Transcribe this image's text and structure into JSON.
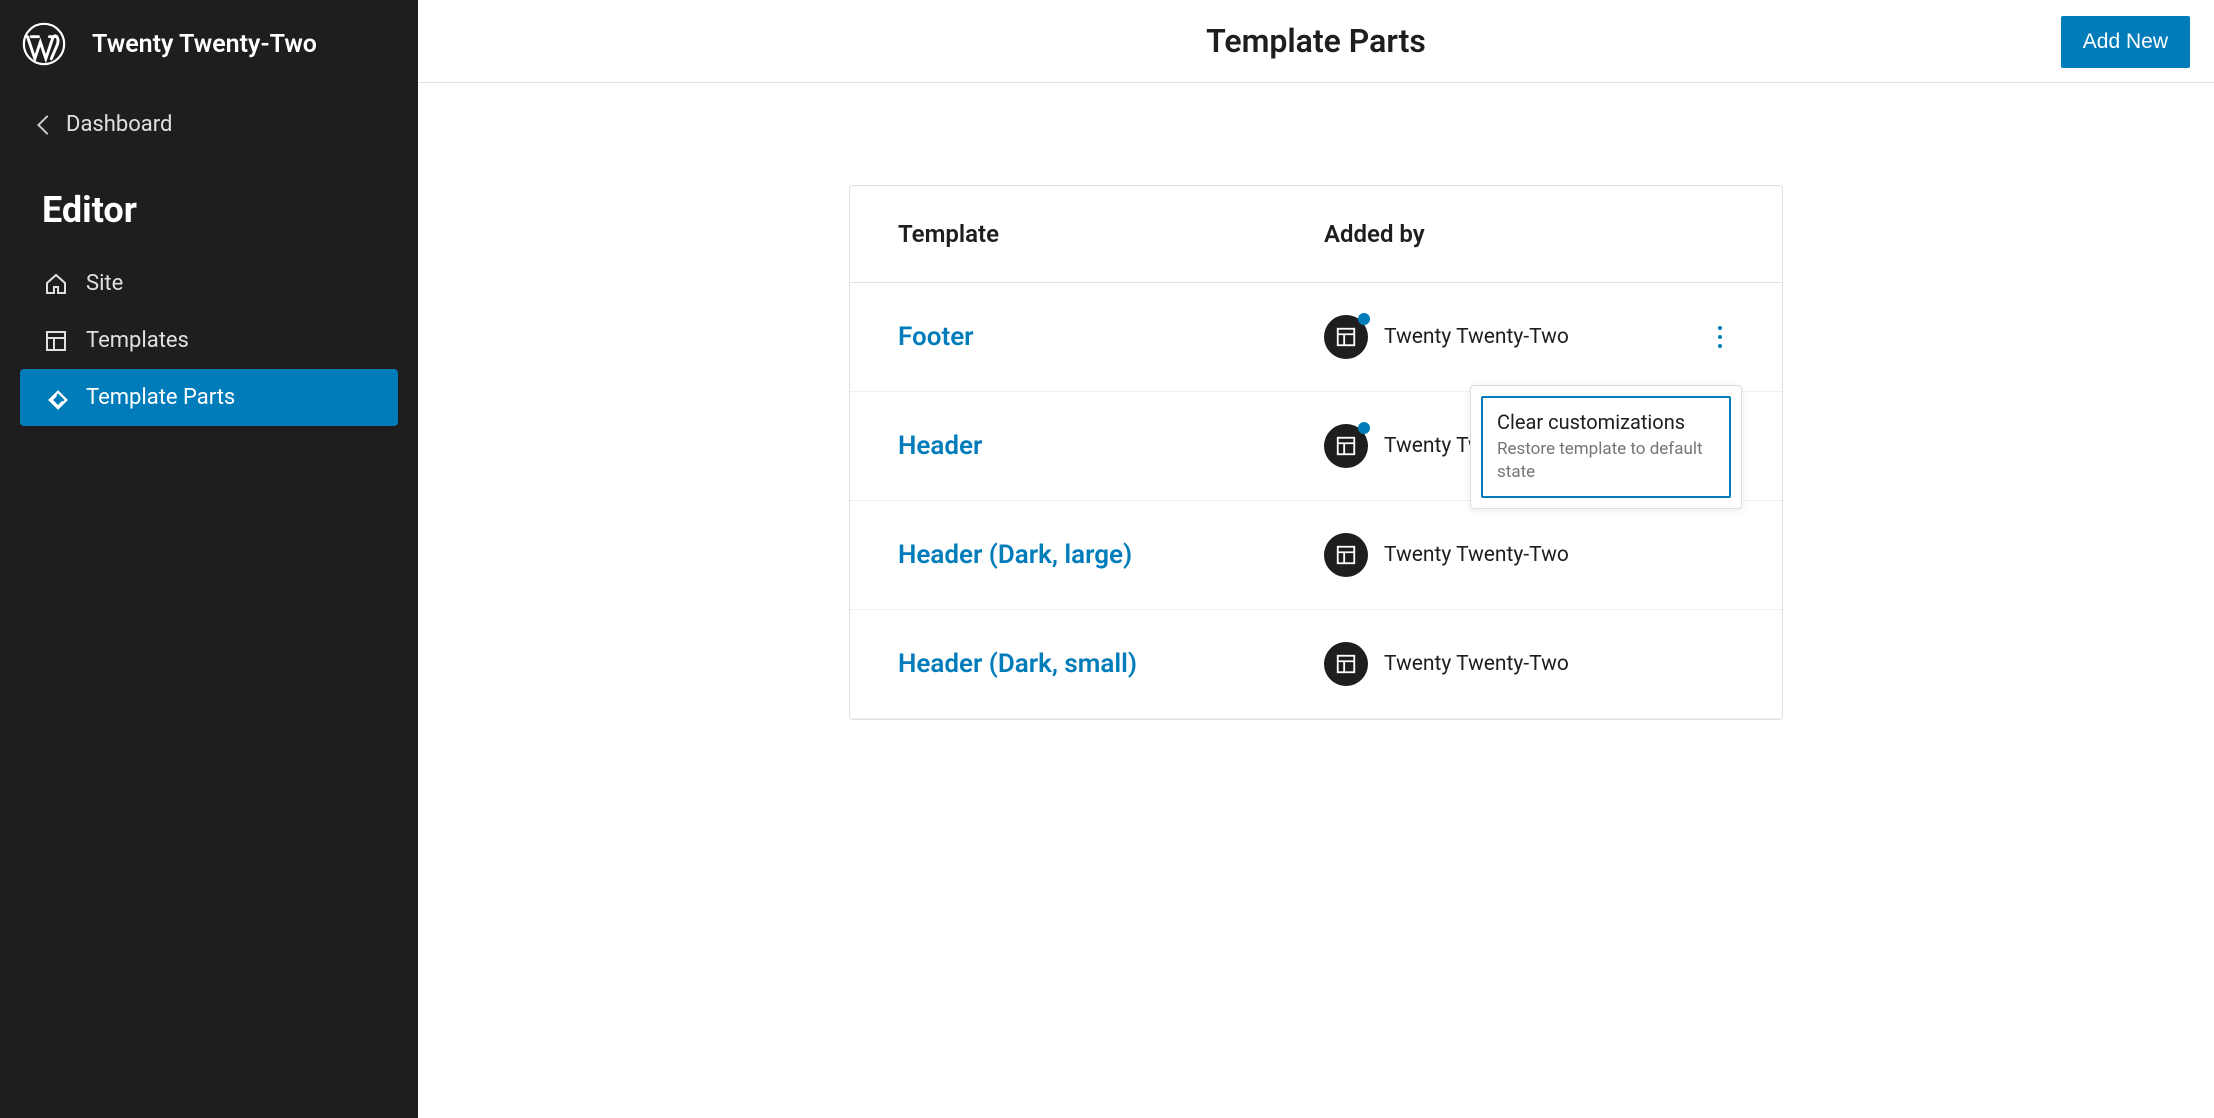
{
  "site_title": "Twenty Twenty-Two",
  "sidebar": {
    "dashboard_label": "Dashboard",
    "section_title": "Editor",
    "nav": [
      {
        "label": "Site",
        "icon": "home-icon",
        "active": false
      },
      {
        "label": "Templates",
        "icon": "layout-icon",
        "active": false
      },
      {
        "label": "Template Parts",
        "icon": "diamond-icon",
        "active": true
      }
    ]
  },
  "header": {
    "page_title": "Template Parts",
    "add_new_label": "Add New"
  },
  "table": {
    "col_template": "Template",
    "col_added_by": "Added by",
    "rows": [
      {
        "name": "Footer",
        "added_by": "Twenty Twenty-Two",
        "customized": true,
        "has_actions": true
      },
      {
        "name": "Header",
        "added_by": "Twenty Twenty-Two",
        "customized": true,
        "has_actions": false
      },
      {
        "name": "Header (Dark, large)",
        "added_by": "Twenty Twenty-Two",
        "customized": false,
        "has_actions": false
      },
      {
        "name": "Header (Dark, small)",
        "added_by": "Twenty Twenty-Two",
        "customized": false,
        "has_actions": false
      }
    ]
  },
  "popover": {
    "title": "Clear customizations",
    "subtitle": "Restore template to default state"
  }
}
